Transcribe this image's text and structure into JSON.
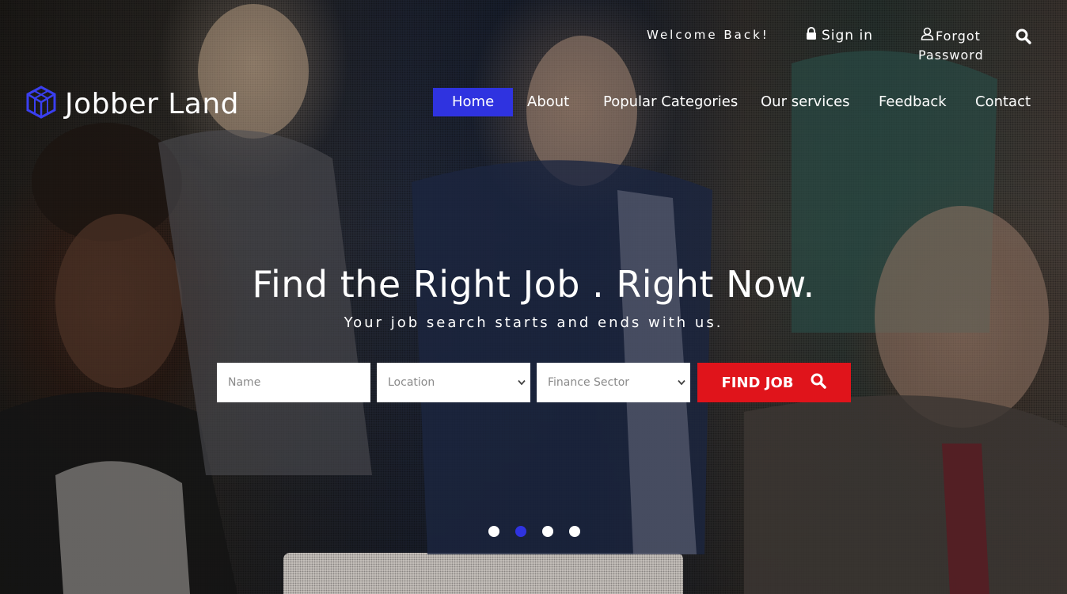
{
  "header": {
    "welcome": "Welcome Back!",
    "signin_label": "Sign in",
    "forgot_line1": "Forgot",
    "forgot_line2": "Password"
  },
  "logo": {
    "text": "Jobber Land"
  },
  "nav": {
    "items": [
      {
        "label": "Home",
        "active": true
      },
      {
        "label": "About"
      },
      {
        "label": "Popular Categories"
      },
      {
        "label": "Our services"
      },
      {
        "label": "Feedback"
      },
      {
        "label": "Contact"
      }
    ]
  },
  "hero": {
    "headline": "Find the Right Job . Right Now.",
    "subheadline": "Your job search starts and ends with us."
  },
  "search_form": {
    "name_placeholder": "Name",
    "location_value": "Location",
    "sector_value": "Finance Sector",
    "button_label": "FIND JOB"
  },
  "carousel": {
    "slide_count": 4,
    "active_index": 1
  },
  "colors": {
    "accent": "#2f33e0",
    "button": "#e0141b"
  },
  "icons": [
    "lock-icon",
    "user-icon",
    "search-icon",
    "logo-cube-icon",
    "chevron-down-icon"
  ]
}
